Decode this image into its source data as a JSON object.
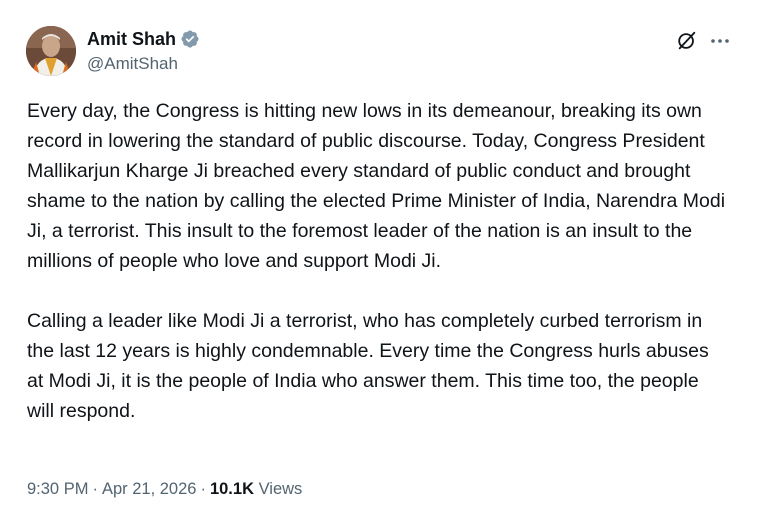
{
  "author": {
    "display_name": "Amit Shah",
    "handle": "@AmitShah",
    "verified_icon": "verified-badge-icon",
    "verified_color": "#829aab"
  },
  "actions": {
    "grok_icon": "grok-icon",
    "more_icon": "more-horizontal-icon"
  },
  "tweet": {
    "paragraphs": [
      "Every day, the Congress is hitting new lows in its demeanour, breaking its own record in lowering the standard of public discourse. Today, Congress President Mallikarjun Kharge Ji breached every standard of public conduct and brought shame to the nation by calling the elected Prime Minister of India, Narendra Modi Ji, a terrorist. This insult to the foremost leader of the nation is an insult to the millions of people who love and support Modi Ji.",
      "Calling a leader like Modi Ji a terrorist, who has completely curbed terrorism in the last 12 years is highly condemnable. Every time the Congress hurls abuses at Modi Ji, it is the people of India who answer them. This time too, the people will respond."
    ]
  },
  "meta": {
    "time": "9:30 PM",
    "separator1": "·",
    "date": "Apr 21, 2026",
    "separator2": "·",
    "views_count": "10.1K",
    "views_label": "Views"
  },
  "colors": {
    "text": "#0f1419",
    "secondary": "#536471",
    "background": "#ffffff"
  }
}
